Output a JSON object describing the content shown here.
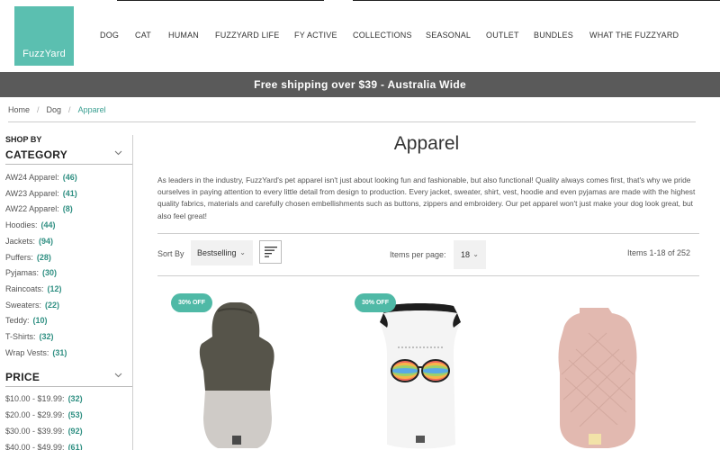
{
  "header": {
    "logo_text": "FuzzYard",
    "nav": [
      "DOG",
      "CAT",
      "HUMAN",
      "FUZZYARD LIFE",
      "FY ACTIVE",
      "COLLECTIONS",
      "SEASONAL",
      "OUTLET",
      "BUNDLES",
      "WHAT THE FUZZYARD"
    ]
  },
  "banner": {
    "text": "Free shipping over $39 - Australia Wide"
  },
  "breadcrumb": [
    "Home",
    "Dog",
    "Apparel"
  ],
  "sidebar": {
    "shop_by": "SHOP BY",
    "category_heading": "CATEGORY",
    "categories": [
      {
        "label": "AW24 Apparel:",
        "count": "(46)"
      },
      {
        "label": "AW23 Apparel:",
        "count": "(41)"
      },
      {
        "label": "AW22 Apparel:",
        "count": "(8)"
      },
      {
        "label": "Hoodies:",
        "count": "(44)"
      },
      {
        "label": "Jackets:",
        "count": "(94)"
      },
      {
        "label": "Puffers:",
        "count": "(28)"
      },
      {
        "label": "Pyjamas:",
        "count": "(30)"
      },
      {
        "label": "Raincoats:",
        "count": "(12)"
      },
      {
        "label": "Sweaters:",
        "count": "(22)"
      },
      {
        "label": "Teddy:",
        "count": "(10)"
      },
      {
        "label": "T-Shirts:",
        "count": "(32)"
      },
      {
        "label": "Wrap Vests:",
        "count": "(31)"
      }
    ],
    "price_heading": "PRICE",
    "prices": [
      {
        "label": "$10.00 - $19.99:",
        "count": "(32)"
      },
      {
        "label": "$20.00 - $29.99:",
        "count": "(53)"
      },
      {
        "label": "$30.00 - $39.99:",
        "count": "(92)"
      },
      {
        "label": "$40.00 - $49.99:",
        "count": "(61)"
      }
    ]
  },
  "main": {
    "title": "Apparel",
    "intro": "As leaders in the industry, FuzzYard's pet apparel isn't just about looking fun and fashionable, but also functional! Quality always comes first, that's why we pride ourselves in paying attention to every little detail from design to production. Every jacket, sweater, shirt, vest, hoodie and even pyjamas are made with the highest quality fabrics, materials and carefully chosen embellishments such as buttons, zippers and embroidery. Our pet apparel won't just make your dog look great, but also feel great!",
    "sort_label": "Sort By",
    "sort_value": "Bestselling",
    "items_per_page_label": "Items per page:",
    "items_per_page_value": "18",
    "items_count": "Items 1-18 of 252"
  },
  "products": [
    {
      "badge": "30% OFF",
      "image_icon": "hoodie-image",
      "colors": {
        "top": "#56544a",
        "bottom": "#cfcbc7"
      }
    },
    {
      "badge": "30% OFF",
      "image_icon": "tshirt-image",
      "colors": {
        "body": "#f4f4f4",
        "trim": "#1e1e1e"
      }
    },
    {
      "badge": "",
      "image_icon": "puffer-vest-image",
      "colors": {
        "body": "#e2b9b0"
      }
    }
  ],
  "colors": {
    "accent": "#4fb9a6",
    "banner": "#5a5a5a",
    "logo": "#5bbfb0"
  }
}
